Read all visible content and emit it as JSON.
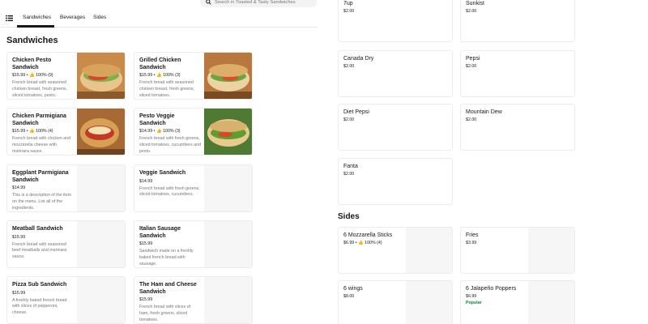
{
  "nav": {
    "tabs": [
      {
        "label": "Sandwiches"
      },
      {
        "label": "Beverages"
      },
      {
        "label": "Sides"
      }
    ],
    "search_placeholder": "Search in Toasted & Tasty Sandwiches"
  },
  "sections": {
    "sandwiches_title": "Sandwiches",
    "sides_title": "Sides"
  },
  "sandwiches": [
    {
      "name": "Chicken Pesto Sandwich",
      "meta": "$15.99 • 👍 100% (9)",
      "desc": "French bread with seasoned chicken breast, fresh greens, sliced tomatoes, pesto."
    },
    {
      "name": "Grilled Chicken Sandwich",
      "meta": "$15.99 • 👍 100% (3)",
      "desc": "French bread with seasoned chicken breast, fresh greens, sliced tomatoes."
    },
    {
      "name": "Chicken Parmigiana Sandwich",
      "meta": "$15.99 • 👍 100% (4)",
      "desc": "French bread with chicken and mozzarella cheese with marinara sauce."
    },
    {
      "name": "Pesto Veggie Sandwich",
      "meta": "$14.99 • 👍 100% (3)",
      "desc": "French bread with fresh greens, sliced tomatoes, cucumbers and pesto."
    },
    {
      "name": "Eggplant Parmigiana Sandwich",
      "meta": "$14.99",
      "desc": "This is a description of the item on the menu. List all of the ingredients."
    },
    {
      "name": "Veggie Sandwich",
      "meta": "$14.99",
      "desc": "French bread with fresh greens, sliced tomatoes, cucumbers."
    },
    {
      "name": "Meatball Sandwich",
      "meta": "$15.99",
      "desc": "French bread with seasoned beef meatballs and marinara sauce."
    },
    {
      "name": "Italian Sausage Sandwich",
      "meta": "$15.99",
      "desc": "Sandwich made on a freshly baked french bread with sausage."
    },
    {
      "name": "Pizza Sub Sandwich",
      "meta": "$15.99",
      "desc": "A freshly baked french bread with slices of pepperoni, cheese."
    },
    {
      "name": "The Ham and Cheese Sandwich",
      "meta": "$15.99",
      "desc": "French bread with slices of ham, fresh greens, sliced tomatoes."
    }
  ],
  "beverages": [
    {
      "name": "7up",
      "price": "$2.00"
    },
    {
      "name": "Sunkist",
      "price": "$2.00"
    },
    {
      "name": "Canada Dry",
      "price": "$2.00"
    },
    {
      "name": "Pepsi",
      "price": "$2.00"
    },
    {
      "name": "Diet Pepsi",
      "price": "$2.00"
    },
    {
      "name": "Mountain Dew",
      "price": "$2.00"
    },
    {
      "name": "Fanta",
      "price": "$2.00"
    }
  ],
  "sides": [
    {
      "name": "6 Mozzarella Sticks",
      "price": "$6.99 • 👍 100% (4)"
    },
    {
      "name": "Fries",
      "price": "$3.99"
    },
    {
      "name": "6 wings",
      "price": "$8.00"
    },
    {
      "name": "6 Jalapeño Poppers",
      "price": "$6.99",
      "tag": "Popular"
    }
  ]
}
